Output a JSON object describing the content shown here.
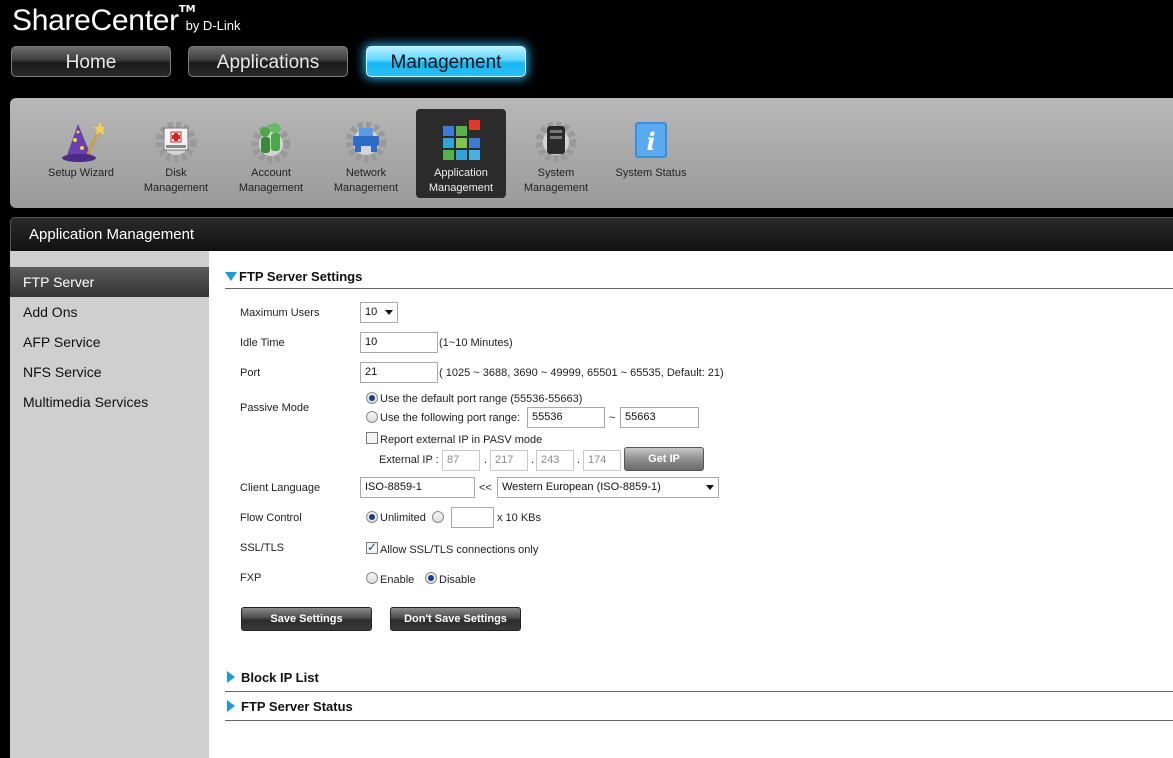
{
  "brand": {
    "name": "ShareCenter",
    "tm": "TM",
    "by": "by D-Link"
  },
  "main_tabs": [
    {
      "label": "Home"
    },
    {
      "label": "Applications"
    },
    {
      "label": "Management",
      "active": true
    }
  ],
  "toolbar": [
    {
      "label": "Setup Wizard",
      "icon": "wizard-icon"
    },
    {
      "label": "Disk\nManagement",
      "icon": "disk-management-icon"
    },
    {
      "label": "Account\nManagement",
      "icon": "account-management-icon"
    },
    {
      "label": "Network\nManagement",
      "icon": "network-management-icon"
    },
    {
      "label": "Application\nManagement",
      "icon": "application-management-icon",
      "active": true
    },
    {
      "label": "System\nManagement",
      "icon": "system-management-icon"
    },
    {
      "label": "System Status",
      "icon": "system-status-icon"
    }
  ],
  "panel": {
    "title": "Application Management"
  },
  "sidebar": {
    "items": [
      {
        "label": "FTP Server",
        "active": true
      },
      {
        "label": "Add Ons"
      },
      {
        "label": "AFP Service"
      },
      {
        "label": "NFS Service"
      },
      {
        "label": "Multimedia Services"
      }
    ]
  },
  "ftp": {
    "section_title": "FTP Server Settings",
    "max_users": {
      "label": "Maximum Users",
      "value": "10"
    },
    "idle_time": {
      "label": "Idle Time",
      "value": "10",
      "hint": "(1~10 Minutes)"
    },
    "port": {
      "label": "Port",
      "value": "21",
      "hint": "( 1025 ~ 3688, 3690 ~ 49999, 65501 ~ 65535, Default: 21)"
    },
    "passive": {
      "label": "Passive Mode",
      "default_option": "Use the default port range (55536-55663)",
      "custom_option": "Use the following port range:",
      "range_from": "55536",
      "range_sep": "~",
      "range_to": "55663",
      "report_ip": "Report external IP in PASV mode",
      "external_ip_label": "External IP :",
      "ip": [
        "87",
        "217",
        "243",
        "174"
      ],
      "dot": ".",
      "get_ip_button": "Get IP"
    },
    "client_language": {
      "label": "Client Language",
      "value": "ISO-8859-1",
      "sep": "<<",
      "selected": "Western European (ISO-8859-1)"
    },
    "flow_control": {
      "label": "Flow Control",
      "unlimited": "Unlimited",
      "value": "",
      "unit": "x 10 KBs"
    },
    "ssl": {
      "label": "SSL/TLS",
      "option": "Allow SSL/TLS connections only"
    },
    "fxp": {
      "label": "FXP",
      "enable": "Enable",
      "disable": "Disable"
    },
    "save_button": "Save Settings",
    "dont_save_button": "Don't Save Settings"
  },
  "sections": [
    {
      "title": "Block IP List"
    },
    {
      "title": "FTP Server Status"
    }
  ],
  "colors": {
    "accent": "#1e9ad6",
    "active_tab": "#28c0f5"
  }
}
